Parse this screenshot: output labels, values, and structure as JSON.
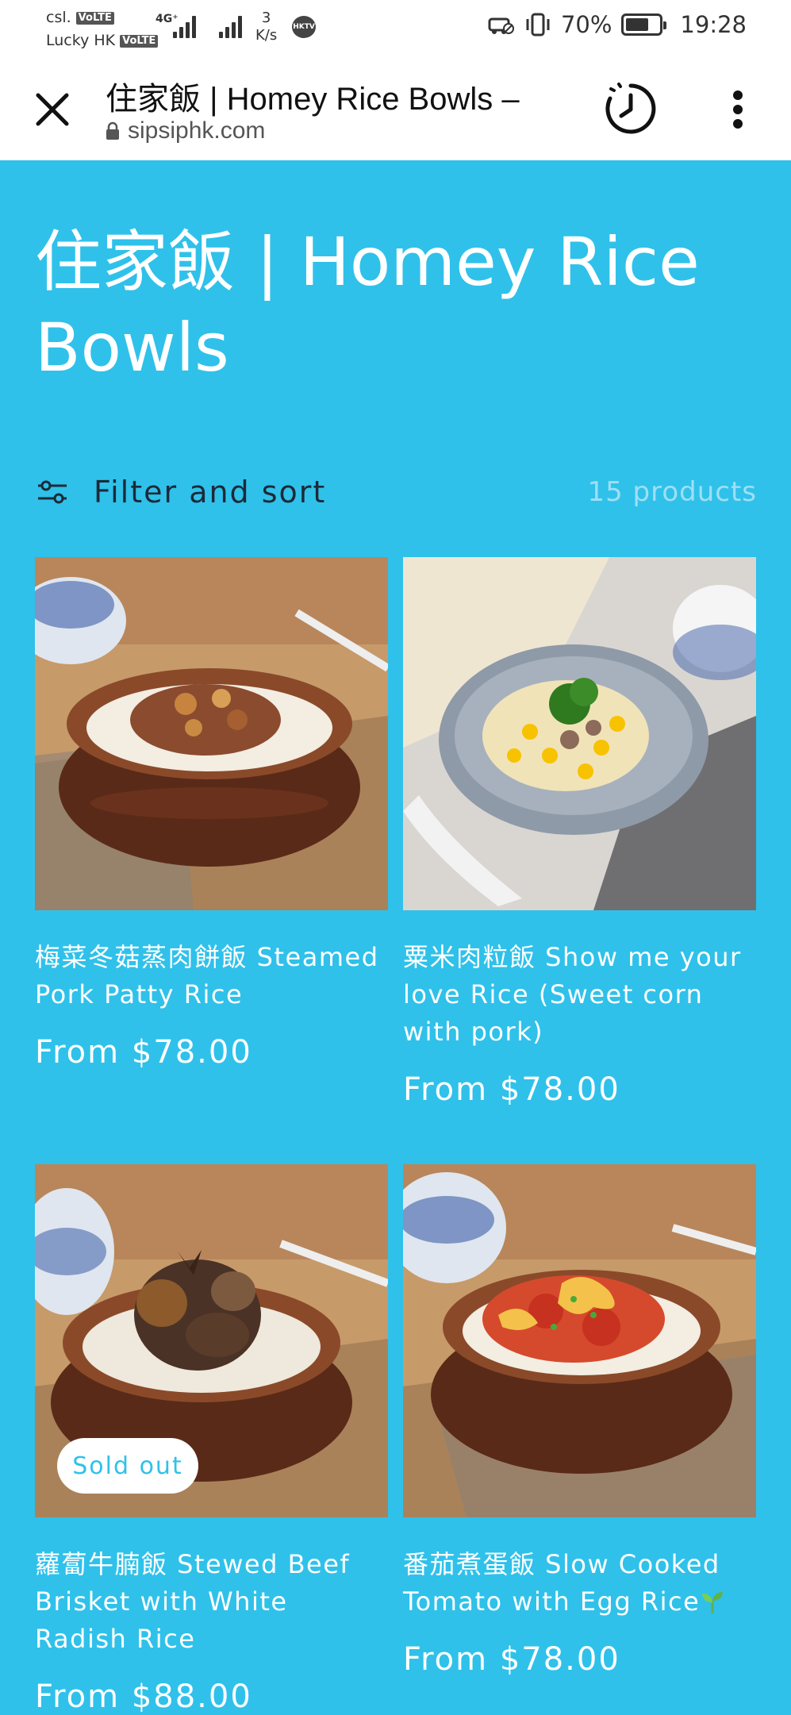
{
  "status_bar": {
    "carrier1": "csl.",
    "carrier2": "Lucky HK",
    "volte": "VoLTE",
    "net_type": "4G⁺",
    "speed_value": "3",
    "speed_unit": "K/s",
    "app_badge": "HKTV",
    "battery": "70%",
    "battery_level": 0.7,
    "time": "19:28"
  },
  "browser": {
    "tab_title": "住家飯 | Homey Rice Bowls –",
    "url": "sipsiphk.com"
  },
  "collection": {
    "title": "住家飯 | Homey Rice Bowls",
    "filter_label": "Filter and sort",
    "product_count": "15 products"
  },
  "products": [
    {
      "title": "梅菜冬菇蒸肉餅飯 Steamed Pork Patty Rice",
      "price": "From $78.00",
      "badge": ""
    },
    {
      "title": "粟米肉粒飯 Show me your love Rice (Sweet corn with pork)",
      "price": "From $78.00",
      "badge": ""
    },
    {
      "title": "蘿蔔牛腩飯 Stewed Beef Brisket with White Radish Rice",
      "price": "From $88.00",
      "badge": "Sold out"
    },
    {
      "title": "番茄煮蛋飯 Slow Cooked Tomato with Egg Rice",
      "price": "From $78.00",
      "badge": ""
    }
  ],
  "colors": {
    "page_background": "#2fc1ea",
    "text": "#ffffff",
    "filter_text": "#1c2a38"
  }
}
